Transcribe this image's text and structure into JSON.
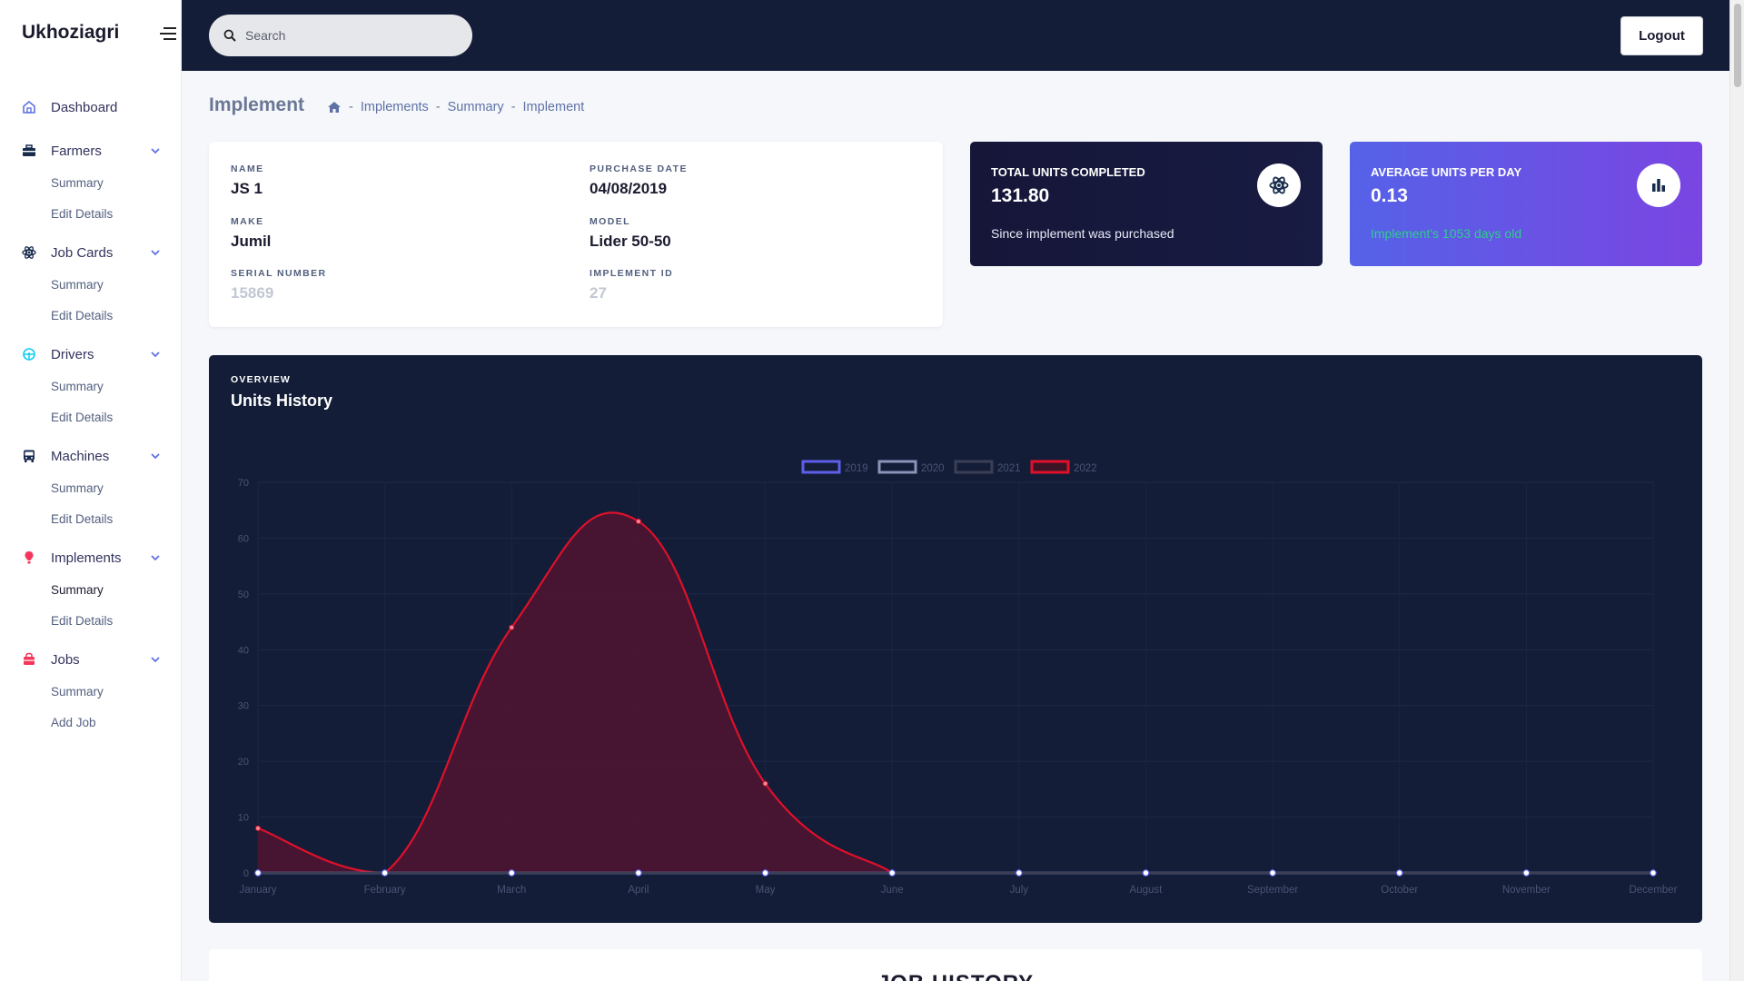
{
  "app": {
    "brand": "Ukhoziagri"
  },
  "sidebar": {
    "dashboard": "Dashboard",
    "groups": [
      {
        "label": "Farmers",
        "icon": "briefcase-icon",
        "items": [
          "Summary",
          "Edit Details"
        ]
      },
      {
        "label": "Job Cards",
        "icon": "atom-icon",
        "items": [
          "Summary",
          "Edit Details"
        ]
      },
      {
        "label": "Drivers",
        "icon": "steering-icon",
        "items": [
          "Summary",
          "Edit Details"
        ]
      },
      {
        "label": "Machines",
        "icon": "bus-icon",
        "items": [
          "Summary",
          "Edit Details"
        ]
      },
      {
        "label": "Implements",
        "icon": "pin-icon",
        "items": [
          "Summary",
          "Edit Details"
        ]
      },
      {
        "label": "Jobs",
        "icon": "basket-icon",
        "items": [
          "Summary",
          "Add Job"
        ]
      }
    ]
  },
  "topbar": {
    "search_placeholder": "Search",
    "logout_label": "Logout"
  },
  "header": {
    "title": "Implement",
    "breadcrumb": [
      "Implements",
      "Summary",
      "Implement"
    ]
  },
  "implement": {
    "name_label": "NAME",
    "name": "JS 1",
    "purchase_date_label": "PURCHASE DATE",
    "purchase_date": "04/08/2019",
    "make_label": "MAKE",
    "make": "Jumil",
    "model_label": "MODEL",
    "model": "Lider 50-50",
    "serial_label": "SERIAL NUMBER",
    "serial": "15869",
    "id_label": "IMPLEMENT ID",
    "id": "27"
  },
  "stats": {
    "total": {
      "title": "TOTAL UNITS COMPLETED",
      "value": "131.80",
      "subtitle": "Since implement was purchased",
      "icon": "atom-icon"
    },
    "average": {
      "title": "AVERAGE UNITS PER DAY",
      "value": "0.13",
      "subtitle": "Implement's 1053 days old",
      "icon": "bar-chart-icon"
    }
  },
  "chart_card": {
    "overline": "OVERVIEW",
    "title": "Units History"
  },
  "chart_data": {
    "type": "line",
    "categories": [
      "January",
      "February",
      "March",
      "April",
      "May",
      "June",
      "July",
      "August",
      "September",
      "October",
      "November",
      "December"
    ],
    "ylim": [
      0,
      70
    ],
    "yticks": [
      0,
      10,
      20,
      30,
      40,
      50,
      60,
      70
    ],
    "legend_position": "top-center",
    "grid": true,
    "series": [
      {
        "name": "2019",
        "color": "#5e5ee8",
        "fill": false,
        "values": [
          0,
          0,
          0,
          0,
          0,
          0,
          0,
          0,
          0,
          0,
          0,
          0
        ]
      },
      {
        "name": "2020",
        "color": "#8a94b8",
        "fill": false,
        "values": [
          0,
          0,
          0,
          0,
          0,
          0,
          0,
          0,
          0,
          0,
          0,
          0
        ]
      },
      {
        "name": "2021",
        "color": "#3b3f55",
        "fill": false,
        "values": [
          0,
          0,
          0,
          0,
          0,
          0,
          0,
          0,
          0,
          0,
          0,
          0
        ]
      },
      {
        "name": "2022",
        "color": "#e0102a",
        "fill": true,
        "values": [
          8,
          0,
          44,
          63,
          16,
          0,
          null,
          null,
          null,
          null,
          null,
          null
        ]
      }
    ]
  },
  "job_history": {
    "title": "JOB HISTORY"
  }
}
